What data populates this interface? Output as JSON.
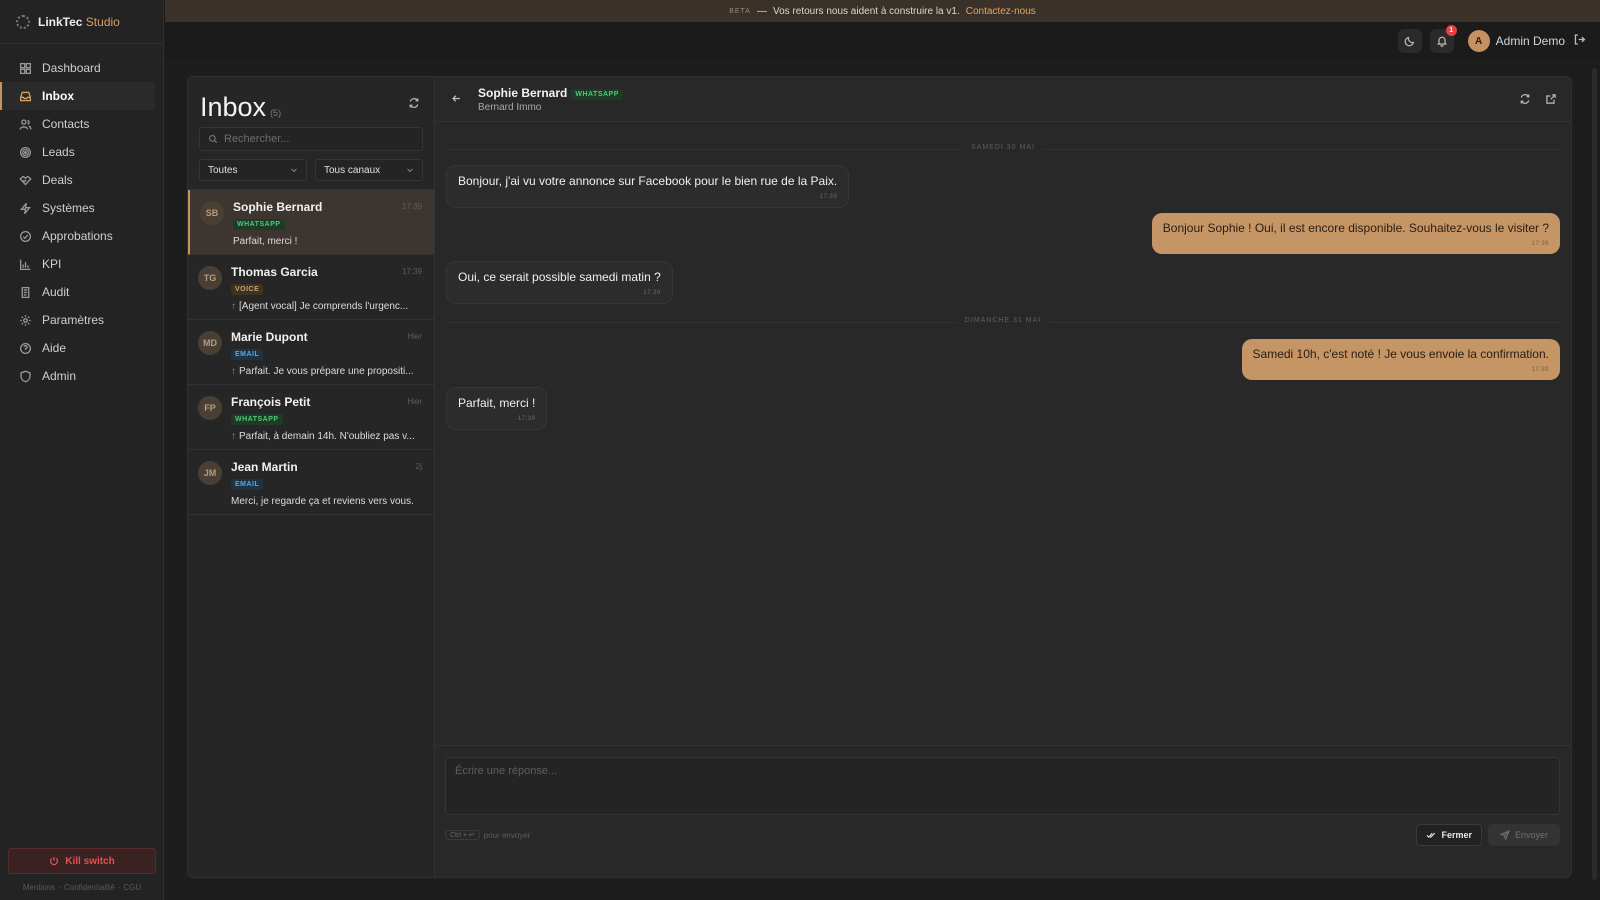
{
  "brand": {
    "name": "LinkTec",
    "suffix": " Studio"
  },
  "sidebar": {
    "items": [
      {
        "label": "Dashboard",
        "icon": "grid-icon"
      },
      {
        "label": "Inbox",
        "icon": "inbox-icon",
        "active": true
      },
      {
        "label": "Contacts",
        "icon": "users-icon"
      },
      {
        "label": "Leads",
        "icon": "target-icon"
      },
      {
        "label": "Deals",
        "icon": "handshake-icon"
      },
      {
        "label": "Systèmes",
        "icon": "bolt-icon"
      },
      {
        "label": "Approbations",
        "icon": "check-circle-icon"
      },
      {
        "label": "KPI",
        "icon": "bar-chart-icon"
      },
      {
        "label": "Audit",
        "icon": "scroll-icon"
      },
      {
        "label": "Paramètres",
        "icon": "gear-icon"
      },
      {
        "label": "Aide",
        "icon": "help-icon"
      },
      {
        "label": "Admin",
        "icon": "shield-icon"
      }
    ],
    "kill_switch": "Kill switch",
    "footer": [
      "Mentions",
      "Confidentialité",
      "CGU"
    ]
  },
  "beta_banner": {
    "tag": "BETA",
    "dash": "—",
    "text": "Vos retours nous aident à construire la v1.",
    "link": "Contactez-nous"
  },
  "topbar": {
    "notification_count": "1",
    "user_initial": "A",
    "user_name": "Admin Demo"
  },
  "inbox": {
    "title": "Inbox",
    "count": "(5)",
    "search_placeholder": "Rechercher...",
    "filter_status": "Toutes",
    "filter_channel": "Tous canaux",
    "conversations": [
      {
        "initials": "SB",
        "name": "Sophie Bernard",
        "time": "17:39",
        "channel": "WHATSAPP",
        "preview": "Parfait, merci !",
        "outgoing": false
      },
      {
        "initials": "TG",
        "name": "Thomas Garcia",
        "time": "17:39",
        "channel": "VOICE",
        "preview": "[Agent vocal] Je comprends l'urgenc...",
        "outgoing": true
      },
      {
        "initials": "MD",
        "name": "Marie Dupont",
        "time": "Hier",
        "channel": "EMAIL",
        "preview": "Parfait. Je vous prépare une propositi...",
        "outgoing": true
      },
      {
        "initials": "FP",
        "name": "François Petit",
        "time": "Hier",
        "channel": "WHATSAPP",
        "preview": "Parfait, à demain 14h. N'oubliez pas v...",
        "outgoing": true
      },
      {
        "initials": "JM",
        "name": "Jean Martin",
        "time": "2j",
        "channel": "EMAIL",
        "preview": "Merci, je regarde ça et reviens vers vous.",
        "outgoing": false
      }
    ]
  },
  "chat": {
    "contact_name": "Sophie Bernard",
    "channel": "WHATSAPP",
    "company": "Bernard Immo",
    "date_separators": [
      "SAMEDI 30 MAI",
      "DIMANCHE 31 MAI"
    ],
    "messages": [
      {
        "direction": "in",
        "text": "Bonjour, j'ai vu votre annonce sur Facebook pour le bien rue de la Paix.",
        "time": "17:39"
      },
      {
        "direction": "out",
        "text": "Bonjour Sophie ! Oui, il est encore disponible. Souhaitez-vous le visiter ?",
        "time": "17:39"
      },
      {
        "direction": "in",
        "text": "Oui, ce serait possible samedi matin ?",
        "time": "17:39"
      },
      {
        "direction": "out",
        "text": "Samedi 10h, c'est noté ! Je vous envoie la confirmation.",
        "time": "17:39"
      },
      {
        "direction": "in",
        "text": "Parfait, merci !",
        "time": "17:39"
      }
    ],
    "composer_placeholder": "Écrire une réponse...",
    "shortcut": "Ctrl + ↵",
    "shortcut_hint": "pour envoyer",
    "close_label": "Fermer",
    "send_label": "Envoyer"
  },
  "colors": {
    "accent": "#c59566",
    "whatsapp": "#4fc972",
    "email": "#5aa9e0",
    "danger": "#e05252"
  }
}
